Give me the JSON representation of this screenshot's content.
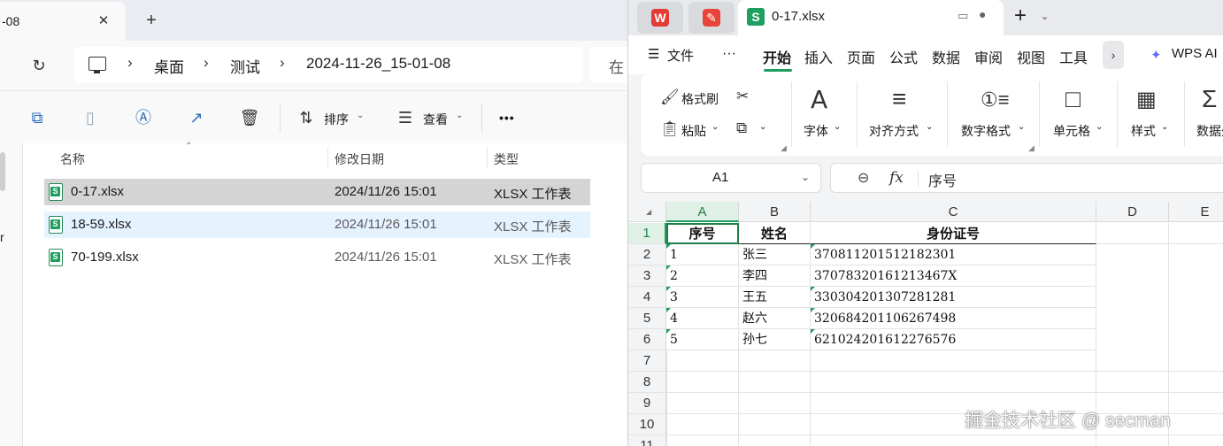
{
  "explorer": {
    "tab_title": "-08",
    "tab_close": "✕",
    "new_tab": "+",
    "refresh_icon": "↻",
    "breadcrumb": [
      "桌面",
      "测试",
      "2024-11-26_15-01-08"
    ],
    "breadcrumb_sep": "›",
    "search_placeholder": "在",
    "toolbar": {
      "sort_label": "排序",
      "view_label": "查看",
      "more_label": "•••"
    },
    "left_partial": "r",
    "columns": [
      "名称",
      "修改日期",
      "类型"
    ],
    "files": [
      {
        "name": "0-17.xlsx",
        "date": "2024/11/26 15:01",
        "type": "XLSX 工作表"
      },
      {
        "name": "18-59.xlsx",
        "date": "2024/11/26 15:01",
        "type": "XLSX 工作表"
      },
      {
        "name": "70-199.xlsx",
        "date": "2024/11/26 15:01",
        "type": "XLSX 工作表"
      }
    ]
  },
  "wps": {
    "doc_title": "0-17.xlsx",
    "doc_icon_letter": "S",
    "plus": "+",
    "menu": {
      "file": "文件",
      "more": "···",
      "items": [
        "开始",
        "插入",
        "页面",
        "公式",
        "数据",
        "审阅",
        "视图",
        "工具"
      ],
      "ai": "WPS AI"
    },
    "ribbon": {
      "format_painter": "格式刷",
      "paste": "粘贴",
      "font": "字体",
      "align": "对齐方式",
      "number_format": "数字格式",
      "cell": "单元格",
      "style": "样式",
      "data_partial": "数据处"
    },
    "name_box": "A1",
    "formula_value": "序号",
    "columns": [
      "A",
      "B",
      "C",
      "D",
      "E"
    ],
    "row_numbers": [
      "1",
      "2",
      "3",
      "4",
      "5",
      "6",
      "7",
      "8",
      "9",
      "10",
      "11"
    ],
    "table": {
      "headers": [
        "序号",
        "姓名",
        "身份证号"
      ],
      "rows": [
        [
          "1",
          "张三",
          "370811201512182301"
        ],
        [
          "2",
          "李四",
          "37078320161213467X"
        ],
        [
          "3",
          "王五",
          "330304201307281281"
        ],
        [
          "4",
          "赵六",
          "320684201106267498"
        ],
        [
          "5",
          "孙七",
          "621024201612276576"
        ]
      ]
    }
  },
  "watermark": "掘金技术社区 @ secman",
  "colors": {
    "accent": "#1e9e5f",
    "selection": "#cce8ff"
  }
}
